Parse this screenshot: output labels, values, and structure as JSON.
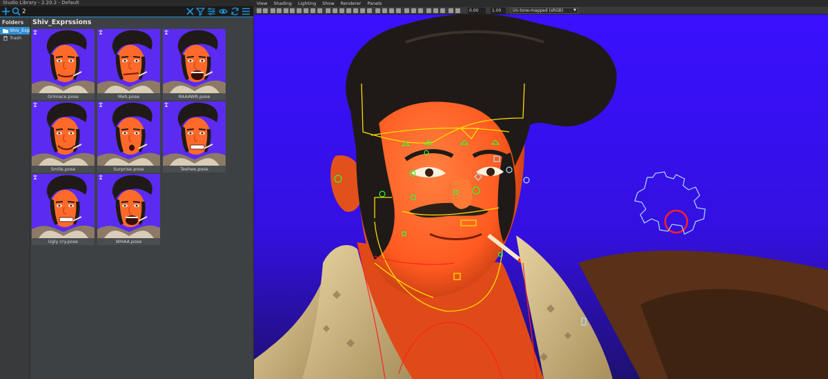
{
  "library": {
    "title": "Studio Library - 2.20.2 - Default",
    "search": {
      "value": "2",
      "placeholder": ""
    },
    "folders_header": "Folders",
    "folders": [
      {
        "label": "Shiv_Expr",
        "selected": true,
        "icon": "folder-icon"
      },
      {
        "label": "Trash",
        "selected": false,
        "icon": "trash-icon"
      }
    ],
    "current_folder": "Shiv_Exprssions",
    "poses": [
      {
        "label": "Grimace.pose",
        "mouth": "grimace"
      },
      {
        "label": "Meh.pose",
        "mouth": "meh"
      },
      {
        "label": "RAAAWR.pose",
        "mouth": "open"
      },
      {
        "label": "Smile.pose",
        "mouth": "smile"
      },
      {
        "label": "Surprise.pose",
        "mouth": "o"
      },
      {
        "label": "Teehee.pose",
        "mouth": "teeth"
      },
      {
        "label": "Ugly cry.pose",
        "mouth": "teeth"
      },
      {
        "label": "WHAA.pose",
        "mouth": "open"
      }
    ],
    "toolbar_icons": [
      "add-icon",
      "search-icon",
      "clear-icon",
      "filter-icon",
      "settings-icon",
      "view-icon",
      "sync-icon",
      "menu-icon"
    ]
  },
  "viewport": {
    "menu": [
      "View",
      "Shading",
      "Lighting",
      "Show",
      "Renderer",
      "Panels"
    ],
    "exposure": "0.00",
    "gamma": "1.00",
    "color_space": "Un-tone-mapped (sRGB)"
  },
  "colors": {
    "accent": "#1e8fd4",
    "viewport_bg": "#3b12ff",
    "skin": "#ff6a2a",
    "hair": "#1f1a17",
    "ctrl_yellow": "#ffe000",
    "ctrl_green": "#2cff2c",
    "ctrl_red": "#ff2020",
    "ctrl_blue": "#aee0ff"
  }
}
